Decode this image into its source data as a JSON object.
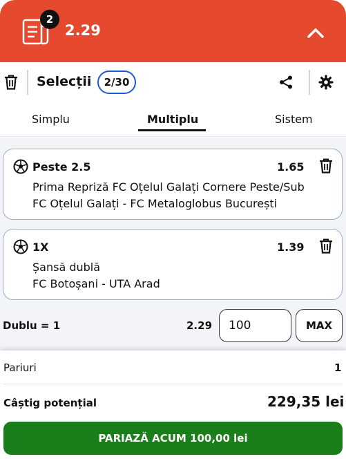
{
  "header": {
    "badge_count": "2",
    "total_odds": "2.29"
  },
  "toolbar": {
    "title": "Selecții",
    "count": "2/30"
  },
  "tabs": [
    {
      "label": "Simplu"
    },
    {
      "label": "Multiplu",
      "active": true
    },
    {
      "label": "Sistem"
    }
  ],
  "selections": [
    {
      "market": "Peste 2.5",
      "odds": "1.65",
      "bet_type": "Prima Repriză FC Oțelul Galați Cornere Peste/Sub",
      "match": "FC Oțelul Galați - FC Metaloglobus București"
    },
    {
      "market": "1X",
      "odds": "1.39",
      "bet_type": "Șansă dublă",
      "match": "FC Botoșani - UTA Arad"
    }
  ],
  "multi": {
    "label": "Dublu = 1",
    "odds": "2.29",
    "stake": "100",
    "max_label": "MAX"
  },
  "summary": {
    "bets_label": "Pariuri",
    "bets_value": "1",
    "win_label": "Câștig potențial",
    "win_value": "229,35 lei",
    "bet_button": "PARIAZĂ ACUM 100,00 lei"
  },
  "colors": {
    "header": "#e54a2f",
    "bet_button": "#1a7f1a",
    "count_border": "#1e57d6"
  },
  "icons": [
    "betslip-icon",
    "chevron-up-icon",
    "trash-icon",
    "share-icon",
    "gear-icon",
    "soccer-ball-icon"
  ]
}
